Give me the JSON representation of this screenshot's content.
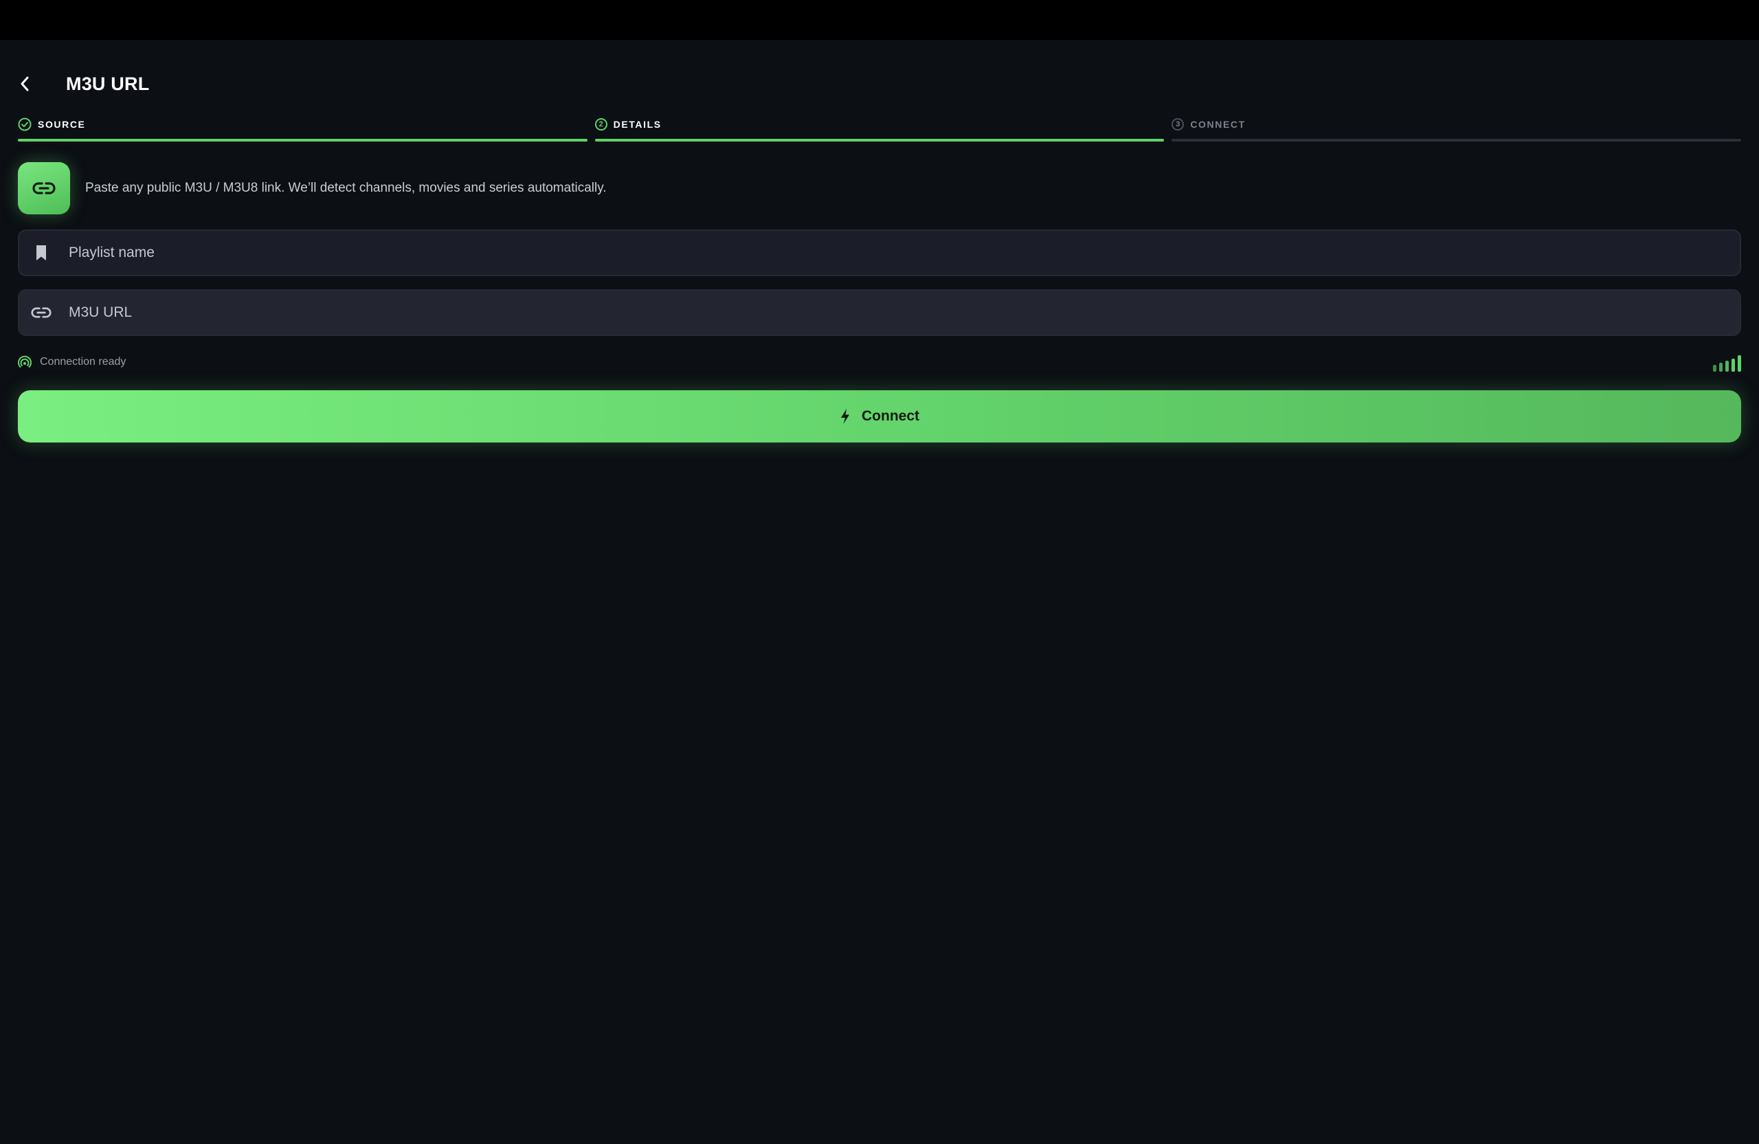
{
  "header": {
    "title": "M3U URL"
  },
  "stepper": {
    "steps": [
      {
        "label": "SOURCE",
        "state": "done"
      },
      {
        "label": "DETAILS",
        "number": "2",
        "state": "active"
      },
      {
        "label": "CONNECT",
        "number": "3",
        "state": "todo"
      }
    ]
  },
  "info": {
    "text": "Paste any public M3U / M3U8 link. We’ll detect channels, movies and series automatically."
  },
  "form": {
    "name_placeholder": "Playlist name",
    "url_placeholder": "M3U URL",
    "name_value": "",
    "url_value": ""
  },
  "status": {
    "text": "Connection ready",
    "signal_level": 5
  },
  "connect": {
    "label": "Connect"
  },
  "colors": {
    "accent": "#5cd467",
    "background": "#0c0f14",
    "field": "#1b1e28"
  },
  "icons": [
    "back-arrow-icon",
    "check-circle-icon",
    "link-icon",
    "bookmark-icon",
    "signal-icon",
    "signal-strength-icon",
    "bolt-icon"
  ]
}
